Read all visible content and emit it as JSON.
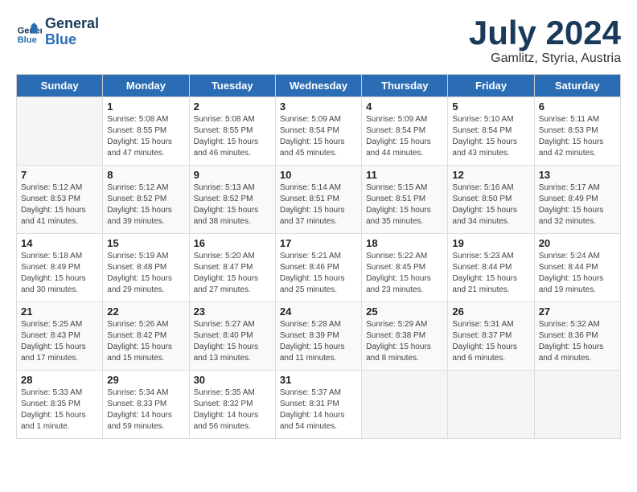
{
  "logo": {
    "line1": "General",
    "line2": "Blue"
  },
  "title": "July 2024",
  "subtitle": "Gamlitz, Styria, Austria",
  "days_of_week": [
    "Sunday",
    "Monday",
    "Tuesday",
    "Wednesday",
    "Thursday",
    "Friday",
    "Saturday"
  ],
  "weeks": [
    [
      {
        "day": "",
        "info": ""
      },
      {
        "day": "1",
        "info": "Sunrise: 5:08 AM\nSunset: 8:55 PM\nDaylight: 15 hours and 47 minutes."
      },
      {
        "day": "2",
        "info": "Sunrise: 5:08 AM\nSunset: 8:55 PM\nDaylight: 15 hours and 46 minutes."
      },
      {
        "day": "3",
        "info": "Sunrise: 5:09 AM\nSunset: 8:54 PM\nDaylight: 15 hours and 45 minutes."
      },
      {
        "day": "4",
        "info": "Sunrise: 5:09 AM\nSunset: 8:54 PM\nDaylight: 15 hours and 44 minutes."
      },
      {
        "day": "5",
        "info": "Sunrise: 5:10 AM\nSunset: 8:54 PM\nDaylight: 15 hours and 43 minutes."
      },
      {
        "day": "6",
        "info": "Sunrise: 5:11 AM\nSunset: 8:53 PM\nDaylight: 15 hours and 42 minutes."
      }
    ],
    [
      {
        "day": "7",
        "info": "Sunrise: 5:12 AM\nSunset: 8:53 PM\nDaylight: 15 hours and 41 minutes."
      },
      {
        "day": "8",
        "info": "Sunrise: 5:12 AM\nSunset: 8:52 PM\nDaylight: 15 hours and 39 minutes."
      },
      {
        "day": "9",
        "info": "Sunrise: 5:13 AM\nSunset: 8:52 PM\nDaylight: 15 hours and 38 minutes."
      },
      {
        "day": "10",
        "info": "Sunrise: 5:14 AM\nSunset: 8:51 PM\nDaylight: 15 hours and 37 minutes."
      },
      {
        "day": "11",
        "info": "Sunrise: 5:15 AM\nSunset: 8:51 PM\nDaylight: 15 hours and 35 minutes."
      },
      {
        "day": "12",
        "info": "Sunrise: 5:16 AM\nSunset: 8:50 PM\nDaylight: 15 hours and 34 minutes."
      },
      {
        "day": "13",
        "info": "Sunrise: 5:17 AM\nSunset: 8:49 PM\nDaylight: 15 hours and 32 minutes."
      }
    ],
    [
      {
        "day": "14",
        "info": "Sunrise: 5:18 AM\nSunset: 8:49 PM\nDaylight: 15 hours and 30 minutes."
      },
      {
        "day": "15",
        "info": "Sunrise: 5:19 AM\nSunset: 8:48 PM\nDaylight: 15 hours and 29 minutes."
      },
      {
        "day": "16",
        "info": "Sunrise: 5:20 AM\nSunset: 8:47 PM\nDaylight: 15 hours and 27 minutes."
      },
      {
        "day": "17",
        "info": "Sunrise: 5:21 AM\nSunset: 8:46 PM\nDaylight: 15 hours and 25 minutes."
      },
      {
        "day": "18",
        "info": "Sunrise: 5:22 AM\nSunset: 8:45 PM\nDaylight: 15 hours and 23 minutes."
      },
      {
        "day": "19",
        "info": "Sunrise: 5:23 AM\nSunset: 8:44 PM\nDaylight: 15 hours and 21 minutes."
      },
      {
        "day": "20",
        "info": "Sunrise: 5:24 AM\nSunset: 8:44 PM\nDaylight: 15 hours and 19 minutes."
      }
    ],
    [
      {
        "day": "21",
        "info": "Sunrise: 5:25 AM\nSunset: 8:43 PM\nDaylight: 15 hours and 17 minutes."
      },
      {
        "day": "22",
        "info": "Sunrise: 5:26 AM\nSunset: 8:42 PM\nDaylight: 15 hours and 15 minutes."
      },
      {
        "day": "23",
        "info": "Sunrise: 5:27 AM\nSunset: 8:40 PM\nDaylight: 15 hours and 13 minutes."
      },
      {
        "day": "24",
        "info": "Sunrise: 5:28 AM\nSunset: 8:39 PM\nDaylight: 15 hours and 11 minutes."
      },
      {
        "day": "25",
        "info": "Sunrise: 5:29 AM\nSunset: 8:38 PM\nDaylight: 15 hours and 8 minutes."
      },
      {
        "day": "26",
        "info": "Sunrise: 5:31 AM\nSunset: 8:37 PM\nDaylight: 15 hours and 6 minutes."
      },
      {
        "day": "27",
        "info": "Sunrise: 5:32 AM\nSunset: 8:36 PM\nDaylight: 15 hours and 4 minutes."
      }
    ],
    [
      {
        "day": "28",
        "info": "Sunrise: 5:33 AM\nSunset: 8:35 PM\nDaylight: 15 hours and 1 minute."
      },
      {
        "day": "29",
        "info": "Sunrise: 5:34 AM\nSunset: 8:33 PM\nDaylight: 14 hours and 59 minutes."
      },
      {
        "day": "30",
        "info": "Sunrise: 5:35 AM\nSunset: 8:32 PM\nDaylight: 14 hours and 56 minutes."
      },
      {
        "day": "31",
        "info": "Sunrise: 5:37 AM\nSunset: 8:31 PM\nDaylight: 14 hours and 54 minutes."
      },
      {
        "day": "",
        "info": ""
      },
      {
        "day": "",
        "info": ""
      },
      {
        "day": "",
        "info": ""
      }
    ]
  ]
}
